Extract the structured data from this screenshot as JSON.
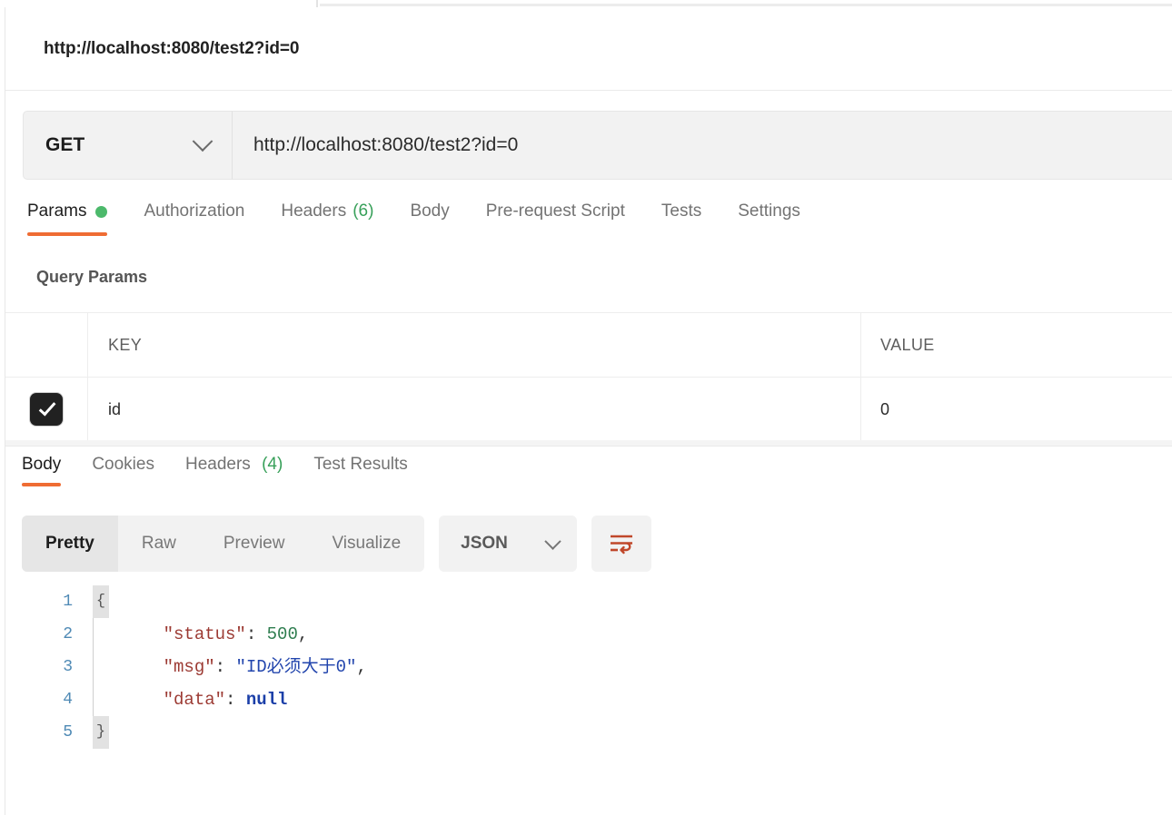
{
  "request": {
    "title": "http://localhost:8080/test2?id=0",
    "method": "GET",
    "url": "http://localhost:8080/test2?id=0",
    "tabs": [
      {
        "label": "Params",
        "badge_dot": true,
        "active": true
      },
      {
        "label": "Authorization",
        "active": false
      },
      {
        "label": "Headers",
        "count": "(6)",
        "active": false
      },
      {
        "label": "Body",
        "active": false
      },
      {
        "label": "Pre-request Script",
        "active": false
      },
      {
        "label": "Tests",
        "active": false
      },
      {
        "label": "Settings",
        "active": false
      }
    ],
    "query_params": {
      "section_label": "Query Params",
      "columns": [
        "KEY",
        "VALUE"
      ],
      "rows": [
        {
          "enabled": true,
          "key": "id",
          "value": "0"
        }
      ]
    }
  },
  "response": {
    "tabs": [
      {
        "label": "Body",
        "active": true
      },
      {
        "label": "Cookies",
        "active": false
      },
      {
        "label": "Headers",
        "count": "(4)",
        "active": false
      },
      {
        "label": "Test Results",
        "active": false
      }
    ],
    "view_modes": [
      {
        "label": "Pretty",
        "active": true
      },
      {
        "label": "Raw",
        "active": false
      },
      {
        "label": "Preview",
        "active": false
      },
      {
        "label": "Visualize",
        "active": false
      }
    ],
    "format": "JSON",
    "wrap_icon": "wrap-text-icon",
    "body_lines": [
      {
        "num": "1",
        "tokens": [
          {
            "t": "{",
            "c": "k-pun"
          }
        ]
      },
      {
        "num": "2",
        "tokens": [
          {
            "t": "    \"status\"",
            "c": "k-key"
          },
          {
            "t": ": ",
            "c": "k-pun"
          },
          {
            "t": "500",
            "c": "k-num"
          },
          {
            "t": ",",
            "c": "k-pun"
          }
        ]
      },
      {
        "num": "3",
        "tokens": [
          {
            "t": "    \"msg\"",
            "c": "k-key"
          },
          {
            "t": ": ",
            "c": "k-pun"
          },
          {
            "t": "\"ID必须大于0\"",
            "c": "k-str"
          },
          {
            "t": ",",
            "c": "k-pun"
          }
        ]
      },
      {
        "num": "4",
        "tokens": [
          {
            "t": "    \"data\"",
            "c": "k-key"
          },
          {
            "t": ": ",
            "c": "k-pun"
          },
          {
            "t": "null",
            "c": "k-null"
          }
        ]
      },
      {
        "num": "5",
        "tokens": [
          {
            "t": "}",
            "c": "k-pun"
          }
        ]
      }
    ]
  },
  "colors": {
    "accent_orange": "#ef6c33",
    "status_green": "#4cb96b",
    "count_green": "#38a05a",
    "wrap_icon": "#c0472a",
    "checkbox": "#212121"
  }
}
